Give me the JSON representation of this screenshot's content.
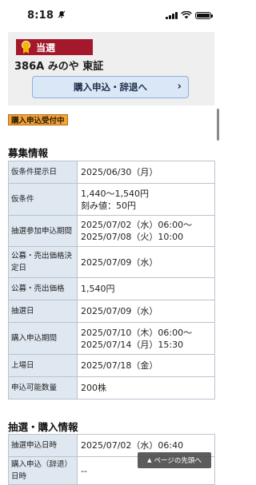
{
  "status_bar": {
    "time": "8:18",
    "bell_icon": "bell-slash-icon"
  },
  "header": {
    "result_badge": "当選",
    "stock_name": "386A みのや 東証",
    "apply_button": "購入申込・辞退へ",
    "apply_chevron": "›"
  },
  "status_tag": "購入申込受付中",
  "recruit": {
    "title": "募集情報",
    "rows": [
      {
        "label": "仮条件提示日",
        "value": "2025/06/30（月）"
      },
      {
        "label": "仮条件",
        "value": "1,440〜1,540円",
        "value2": "刻み値：50円"
      },
      {
        "label": "抽選参加申込期間",
        "value": "2025/07/02（水）06:00〜",
        "value2": "2025/07/08（火）10:00"
      },
      {
        "label": "公募・売出価格決定日",
        "value": "2025/07/09（水）"
      },
      {
        "label": "公募・売出価格",
        "value": "1,540円"
      },
      {
        "label": "抽選日",
        "value": "2025/07/09（水）"
      },
      {
        "label": "購入申込期間",
        "value": "2025/07/10（木）06:00〜",
        "value2": "2025/07/14（月）15:30"
      },
      {
        "label": "上場日",
        "value": "2025/07/18（金）"
      },
      {
        "label": "申込可能数量",
        "value": "200株"
      }
    ]
  },
  "lottery": {
    "title": "抽選・購入情報",
    "rows": [
      {
        "label": "抽選申込日時",
        "value": "2025/07/02（水）06:40"
      },
      {
        "label": "購入申込（辞退）日時",
        "value": "--"
      }
    ]
  },
  "back_to_top": "ページの先頭へ",
  "colors": {
    "badge": "#a3182b",
    "tag": "#f3a33a",
    "label_bg": "#dfe7f0",
    "button_bg": "#d9e7f7"
  }
}
